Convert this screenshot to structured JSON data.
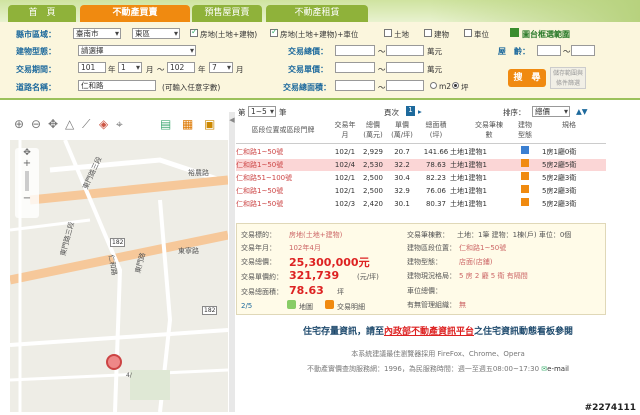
{
  "nav": {
    "tabs": [
      {
        "label": "首　頁"
      },
      {
        "label": "不動產買賣"
      },
      {
        "label": "預售屋買賣"
      },
      {
        "label": "不動產租賃"
      }
    ]
  },
  "form": {
    "county_label": "縣市區域：",
    "county_value": "臺南市",
    "district_value": "東區",
    "types": [
      "房地(土地+建物)",
      "房地(土地+建物)+車位",
      "土地",
      "建物",
      "車位"
    ],
    "map_scope_label": "圖台框選範圍",
    "building_type_label": "建物型態：",
    "building_type_value": "請選擇",
    "total_price_label": "交易總價：",
    "unit_wan": "萬元",
    "age_label": "屋　齡：",
    "period_label": "交易期間：",
    "period_year_from": "101",
    "period_month_from": "1",
    "period_year_to": "102",
    "period_month_to": "7",
    "u_year": "年",
    "u_month": "月",
    "u_to": "～",
    "unit_price_label": "交易單價：",
    "road_label": "道路名稱：",
    "road_value": "仁和路",
    "road_hint": "(可輸入任意字數)",
    "area_label": "交易總面積：",
    "area_m2": "m2",
    "area_ping": "坪",
    "search_button": "搜　尋",
    "save_button": "儲存範圍與條件篩選"
  },
  "map": {
    "labels": [
      "東門路三段",
      "裕農路",
      "東門路三段",
      "東寧路",
      "仁和路",
      "東門路"
    ],
    "markers": [
      "182",
      "182",
      "4/"
    ]
  },
  "results": {
    "per_page_label": "第",
    "per_page_value": "1~5",
    "per_page_unit": "筆",
    "page_label": "頁次",
    "page_value": "1",
    "sort_label": "排序：",
    "sort_value": "總價",
    "headers": [
      "區段位置或區段門牌",
      "交易年月",
      "總價(萬元)",
      "單價(萬/坪)",
      "總面積(坪)",
      "交易筆棟數",
      "建物型態",
      "規格"
    ],
    "rows": [
      {
        "addr": "仁和路1~50號",
        "date": "102/1",
        "total": "2,929",
        "unit": "20.7",
        "area": "141.66",
        "count": "土地1建物1",
        "layout": "1房1廳0衛"
      },
      {
        "addr": "仁和路1~50號",
        "date": "102/4",
        "total": "2,530",
        "unit": "32.2",
        "area": "78.63",
        "count": "土地1建物1",
        "layout": "5房2廳5衛"
      },
      {
        "addr": "仁和路51~100號",
        "date": "102/1",
        "total": "2,500",
        "unit": "30.4",
        "area": "82.23",
        "count": "土地1建物1",
        "layout": "5房2廳3衛"
      },
      {
        "addr": "仁和路1~50號",
        "date": "102/1",
        "total": "2,500",
        "unit": "32.9",
        "area": "76.06",
        "count": "土地1建物1",
        "layout": "5房2廳3衛"
      },
      {
        "addr": "仁和路1~50號",
        "date": "102/3",
        "total": "2,420",
        "unit": "30.1",
        "area": "80.37",
        "count": "土地1建物1",
        "layout": "5房2廳3衛"
      }
    ]
  },
  "detail": {
    "target_label": "交易標的：",
    "target_value": "房地(土地+建物)",
    "ym_label": "交易年月：",
    "ym_value": "102年4月",
    "total_label": "交易總價：",
    "total_value": "25,300,000元",
    "unit_label": "交易單價約：",
    "unit_value": "321,739",
    "unit_suffix": "(元/坪)",
    "area_label": "交易總面積：",
    "area_value": "78.63",
    "area_suffix": "坪",
    "pager": "2/5",
    "map_button": "地圖",
    "detail_button": "交易明細",
    "count_label": "交易筆棟數：",
    "count_value": "土地：1筆 建物：1棟(戶) 車位：0個",
    "location_label": "建物區段位置：",
    "location_value": "仁和路1~50號",
    "form_label": "建物型態：",
    "form_value": "店面(店鋪)",
    "layout_label": "建物現況格局：",
    "layout_value": "5 房 2 廳 5 衛 有隔間",
    "parking_label": "車位總價：",
    "manage_label": "有無管理組織：",
    "manage_value": "無"
  },
  "footer": {
    "notice_pre": "住宅存量資訊，請至",
    "notice_link": "內政部不動產資訊平台",
    "notice_post": "之住宅資訊動態看板參閱",
    "browser": "本系統建議最佳瀏覽器採用 FireFox、Chrome、Opera",
    "service": "不動產實價查詢服務網：1996，為民服務時間：週一至週五08:00~17:30",
    "email": "e-mail",
    "watermark": "#2274111"
  },
  "colors": {
    "accent": "#f08a10",
    "nav_green": "#8fb23a",
    "label_blue": "#1e6a9d",
    "row_highlight": "#fbd6d6"
  }
}
